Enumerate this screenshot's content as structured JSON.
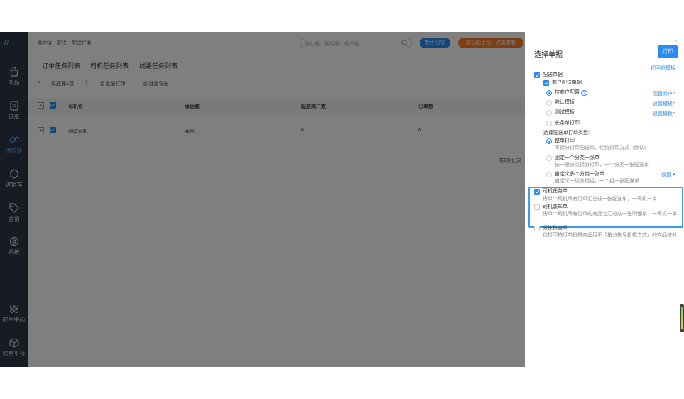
{
  "rail": {
    "logo": "//",
    "items": [
      {
        "label": "商品",
        "icon": "bag-icon"
      },
      {
        "label": "订单",
        "icon": "order-icon"
      },
      {
        "label": "供应链",
        "icon": "supply-chain-icon",
        "active": true
      },
      {
        "label": "进销存",
        "icon": "inventory-icon"
      },
      {
        "label": "营销",
        "icon": "tag-icon"
      },
      {
        "label": "系统",
        "icon": "gear-icon"
      },
      {
        "label": "应用中心",
        "icon": "apps-icon"
      },
      {
        "label": "信息平台",
        "icon": "cube-icon"
      }
    ]
  },
  "topbar": {
    "breadcrumb": [
      "供应链",
      "配送",
      "配送任务"
    ],
    "search_placeholder": "搜功能、搜问题、搜单据",
    "newbie_button": "新手引导",
    "new_feature_button": "新功能上线，点击查看"
  },
  "tabs": [
    "订单任务列表",
    "司机任务列表",
    "线路任务列表"
  ],
  "toolbar": {
    "close": "×",
    "selected": "已选择1项",
    "separator": "|",
    "batch_print": "批量打印",
    "batch_export": "批量导出"
  },
  "table": {
    "columns": [
      "司机名",
      "承运商",
      "配送商户数",
      "订单数"
    ],
    "rows": [
      [
        "测试司机",
        "泰州",
        "6",
        "6"
      ]
    ],
    "total": "共1条记录"
  },
  "drawer": {
    "close": "×",
    "title": "选择单据",
    "print_button": "打印",
    "switch_template": "切回旧模板",
    "delivery_doc": "配送单据",
    "merchant_doc": "商户配送单据",
    "options": [
      {
        "label": "按商户配置",
        "help": "?",
        "link": "配置商户>",
        "selected": true
      },
      {
        "label": "默认模板",
        "link": "设置模板>",
        "selected": false
      },
      {
        "label": "测试模板",
        "link": "设置模板>",
        "selected": false
      },
      {
        "label": "长条单打印",
        "link": "",
        "selected": false
      }
    ],
    "print_type_label": "选择配送单打印类型:",
    "print_types": [
      {
        "label": "整单打印",
        "desc": "不拆分打印配送单，传统打印方式（默认）",
        "selected": true
      },
      {
        "label": "固定一个分类一张单",
        "desc": "按一级分类拆分打印，一个分类一张配送单",
        "selected": false
      },
      {
        "label": "自定义多个分类一张单",
        "desc": "自定义一级分类组，一个组一张配送单",
        "selected": false,
        "link": "设置"
      }
    ],
    "driver_task": {
      "label": "司机任务单",
      "desc": "将单个司机所有订单汇总成一张配送单，一司机一单",
      "checked": true
    },
    "driver_loading": {
      "label": "司机装车单",
      "desc": "将单个司机所有订单的商品名汇总成一张明细单，一司机一单",
      "checked": false
    },
    "sorting": {
      "label": "分拣核查单",
      "desc": "仅打印按订单投框商品用于「按分拣号投框方式」的商品核对",
      "checked": false
    }
  }
}
